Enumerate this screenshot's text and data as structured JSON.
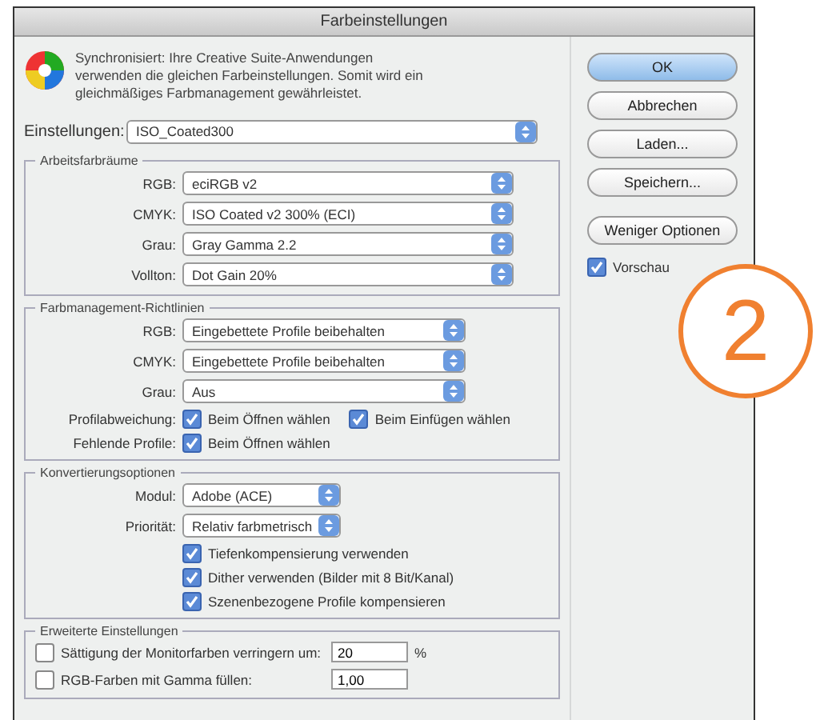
{
  "window": {
    "title": "Farbeinstellungen"
  },
  "description": "Synchronisiert: Ihre Creative Suite-Anwendungen verwenden die gleichen Farbeinstellungen. Somit wird ein gleichmäßiges Farbmanagement gewährleistet.",
  "settings": {
    "label": "Einstellungen:",
    "value": "ISO_Coated300"
  },
  "sections": [
    {
      "title": "Arbeitsfarbräume",
      "kind": "wide",
      "rows": [
        {
          "kind": "select",
          "label": "RGB:",
          "value": "eciRGB v2"
        },
        {
          "kind": "select",
          "label": "CMYK:",
          "value": "ISO Coated v2 300% (ECI)"
        },
        {
          "kind": "select",
          "label": "Grau:",
          "value": "Gray Gamma 2.2"
        },
        {
          "kind": "select",
          "label": "Vollton:",
          "value": "Dot Gain 20%"
        }
      ]
    },
    {
      "title": "Farbmanagement-Richtlinien",
      "kind": "medium",
      "rows": [
        {
          "kind": "select",
          "label": "RGB:",
          "value": "Eingebettete Profile beibehalten"
        },
        {
          "kind": "select",
          "label": "CMYK:",
          "value": "Eingebettete Profile beibehalten"
        },
        {
          "kind": "select",
          "label": "Grau:",
          "value": "Aus"
        },
        {
          "kind": "checks",
          "label": "Profilabweichung:",
          "checks": [
            {
              "label": "Beim Öffnen wählen",
              "checked": true
            },
            {
              "label": "Beim Einfügen wählen",
              "checked": true
            }
          ]
        },
        {
          "kind": "checks",
          "label": "Fehlende Profile:",
          "checks": [
            {
              "label": "Beim Öffnen wählen",
              "checked": true
            }
          ]
        }
      ]
    },
    {
      "title": "Konvertierungsoptionen",
      "kind": "narrow",
      "rows": [
        {
          "kind": "select",
          "label": "Modul:",
          "value": "Adobe (ACE)"
        },
        {
          "kind": "select",
          "label": "Priorität:",
          "value": "Relativ farbmetrisch"
        },
        {
          "kind": "check",
          "label": "Tiefenkompensierung verwenden",
          "checked": true
        },
        {
          "kind": "check",
          "label": "Dither verwenden (Bilder mit 8 Bit/Kanal)",
          "checked": true
        },
        {
          "kind": "check",
          "label": "Szenenbezogene Profile kompensieren",
          "checked": true
        }
      ]
    },
    {
      "title": "Erweiterte Einstellungen",
      "kind": "wide",
      "rows": [
        {
          "kind": "field",
          "label": "Sättigung der Monitorfarben verringern um:",
          "checked": false,
          "value": "20",
          "unit": "%"
        },
        {
          "kind": "field",
          "label": "RGB-Farben mit Gamma füllen:",
          "checked": false,
          "value": "1,00"
        }
      ]
    }
  ],
  "buttons": [
    {
      "label": "OK",
      "default": true
    },
    {
      "label": "Abbrechen",
      "default": false
    },
    {
      "label": "Laden...",
      "default": false
    },
    {
      "label": "Speichern...",
      "default": false
    },
    {
      "label": "Weniger Optionen",
      "default": false
    }
  ],
  "preview": {
    "label": "Vorschau",
    "checked": true
  },
  "badge": {
    "text": "2"
  }
}
